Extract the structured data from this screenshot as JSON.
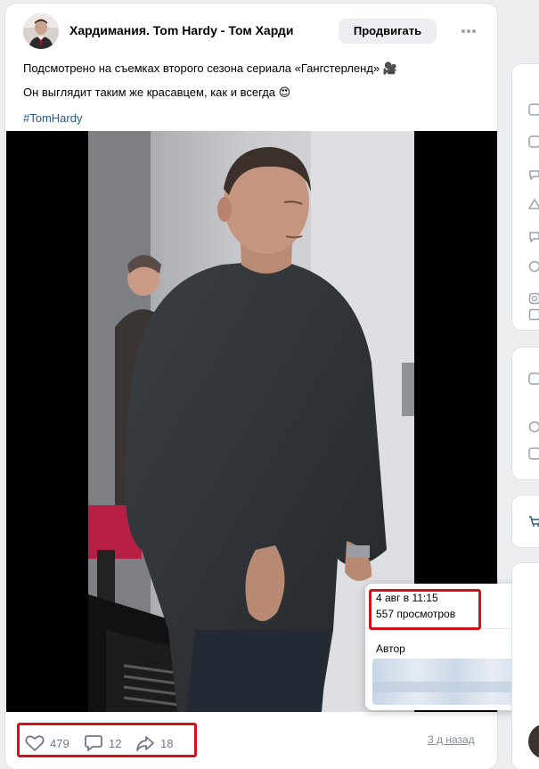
{
  "post": {
    "group_name": "Хардимания. Tom Hardy - Том Харди",
    "promote_label": "Продвигать",
    "text_line1": "Подсмотрено на съемках второго сезона сериала «Гангстерленд» 🎥",
    "text_line2": "Он выглядит таким же красавцем, как и всегда 😍",
    "hashtag": "#TomHardy"
  },
  "actions": {
    "likes": "479",
    "comments": "12",
    "shares": "18",
    "date_link": "3 д назад"
  },
  "popup": {
    "date": "4 авг в 11:15",
    "views": "557 просмотров",
    "author_label": "Автор"
  },
  "colors": {
    "accent_link": "#2a5885",
    "highlight": "#d0131b",
    "page_bg": "#edeef0"
  },
  "icons": [
    "more-icon",
    "like-icon",
    "comment-icon",
    "share-icon"
  ]
}
